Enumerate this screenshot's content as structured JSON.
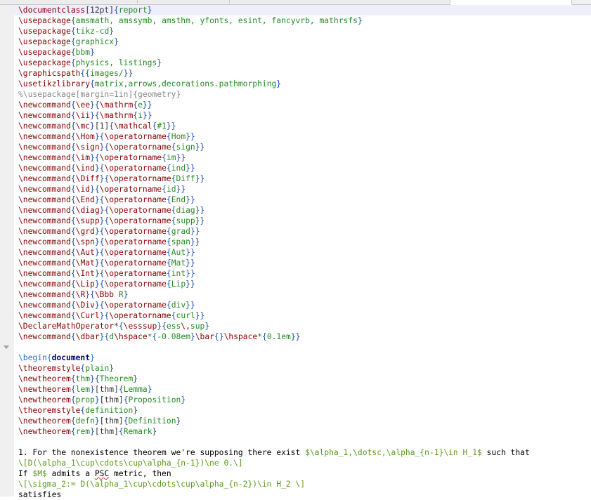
{
  "tabs": [
    {
      "label": "",
      "active": false
    },
    {
      "label": "",
      "active": false
    },
    {
      "label": "",
      "active": true
    },
    {
      "label": "",
      "active": false
    }
  ],
  "editor": {
    "current_line": 0,
    "fold_marker_line": 32,
    "lines": [
      "\\documentclass[12pt]{report}",
      "\\usepackage{amsmath, amssymb, amsthm, yfonts, esint, fancyvrb, mathrsfs}",
      "\\usepackage{tikz-cd}",
      "\\usepackage{graphicx}",
      "\\usepackage{bbm}",
      "\\usepackage{physics, listings}",
      "\\graphicspath{{images/}}",
      "\\usetikzlibrary{matrix,arrows,decorations.pathmorphing}",
      "%\\usepackage[margin=1in]{geometry}",
      "\\newcommand{\\ee}{\\mathrm{e}}",
      "\\newcommand{\\ii}{\\mathrm{i}}",
      "\\newcommand{\\mc}[1]{\\mathcal{#1}}",
      "\\newcommand{\\Hom}{\\operatorname{Hom}}",
      "\\newcommand{\\sign}{\\operatorname{sign}}",
      "\\newcommand{\\im}{\\operatorname{im}}",
      "\\newcommand{\\ind}{\\operatorname{ind}}",
      "\\newcommand{\\Diff}{\\operatorname{Diff}}",
      "\\newcommand{\\id}{\\operatorname{id}}",
      "\\newcommand{\\End}{\\operatorname{End}}",
      "\\newcommand{\\diag}{\\operatorname{diag}}",
      "\\newcommand{\\supp}{\\operatorname{supp}}",
      "\\newcommand{\\grd}{\\operatorname{grad}}",
      "\\newcommand{\\spn}{\\operatorname{span}}",
      "\\newcommand{\\Aut}{\\operatorname{Aut}}",
      "\\newcommand{\\Mat}{\\operatorname{Mat}}",
      "\\newcommand{\\Int}{\\operatorname{int}}",
      "\\newcommand{\\Lip}{\\operatorname{Lip}}",
      "\\newcommand{\\R}{\\Bbb R}",
      "\\newcommand{\\Div}{\\operatorname{div}}",
      "\\newcommand{\\Curl}{\\operatorname{curl}}",
      "\\DeclareMathOperator*{\\esssup}{ess\\,sup}",
      "\\newcommand{\\dbar}{d\\hspace*{-0.08em}\\bar{}\\hspace*{0.1em}}",
      "",
      "\\begin{document}",
      "\\theoremstyle{plain}",
      "\\newtheorem{thm}{Theorem}",
      "\\newtheorem{lem}[thm]{Lemma}",
      "\\newtheorem{prop}[thm]{Proposition}",
      "\\theoremstyle{definition}",
      "\\newtheorem{defn}[thm]{Definition}",
      "\\newtheorem{rem}[thm]{Remark}",
      "",
      "1. For the nonexistence theorem we're supposing there exist $\\alpha_1,\\dotsc,\\alpha_{n-1}\\in H_1$ such that",
      "\\[D(\\alpha_1\\cup\\cdots\\cup\\alpha_{n-1})\\ne 0.\\]",
      "If $M$ admits a PSC metric, then",
      "\\[\\sigma_2:= D(\\alpha_1\\cup\\cdots\\cup\\alpha_{n-2})\\in H_2 \\]",
      "satisfies"
    ],
    "misspelled_words": [
      "PSC"
    ]
  },
  "colors": {
    "command": "#8b0000",
    "brace": "#1f4fa8",
    "argument": "#228b22",
    "comment": "#888888",
    "environment_keyword": "#1f6fd8",
    "math": "#5a9a1a",
    "current_line_bg": "#eeeefc",
    "gutter_bg": "#f0f0f0"
  }
}
